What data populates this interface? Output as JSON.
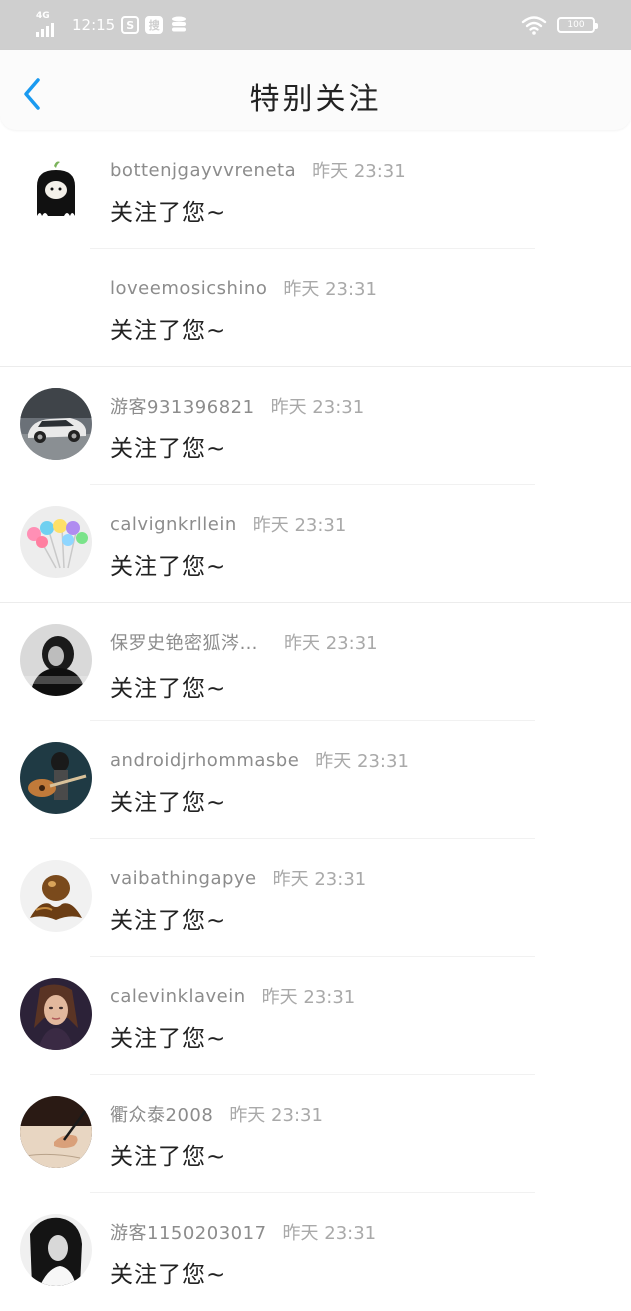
{
  "status_bar": {
    "network": "4G",
    "time": "12:15",
    "battery": "100"
  },
  "header": {
    "title": "特别关注"
  },
  "items": [
    {
      "name": "bottenjgayvvreneta",
      "time": "昨天 23:31",
      "action": "关注了您~"
    },
    {
      "name": "loveemosicshino",
      "time": "昨天 23:31",
      "action": "关注了您~"
    },
    {
      "name": "游客931396821",
      "time": "昨天 23:31",
      "action": "关注了您~"
    },
    {
      "name": "calvignkrllein",
      "time": "昨天 23:31",
      "action": "关注了您~"
    },
    {
      "name": "保罗史铯密狐涔…",
      "time": "昨天 23:31",
      "action": "关注了您~"
    },
    {
      "name": "androidjrhommasbe",
      "time": "昨天 23:31",
      "action": "关注了您~"
    },
    {
      "name": "vaibathingapye",
      "time": "昨天 23:31",
      "action": "关注了您~"
    },
    {
      "name": "calevinklavein",
      "time": "昨天 23:31",
      "action": "关注了您~"
    },
    {
      "name": "衢众泰2008",
      "time": "昨天 23:31",
      "action": "关注了您~"
    },
    {
      "name": "游客1150203017",
      "time": "昨天 23:31",
      "action": "关注了您~"
    }
  ],
  "icons": {
    "back": "chevron-left-icon",
    "wifi": "wifi-icon",
    "battery": "battery-icon"
  },
  "colors": {
    "accent": "#1a9af0",
    "status_bar_bg": "#cfcfcf"
  }
}
